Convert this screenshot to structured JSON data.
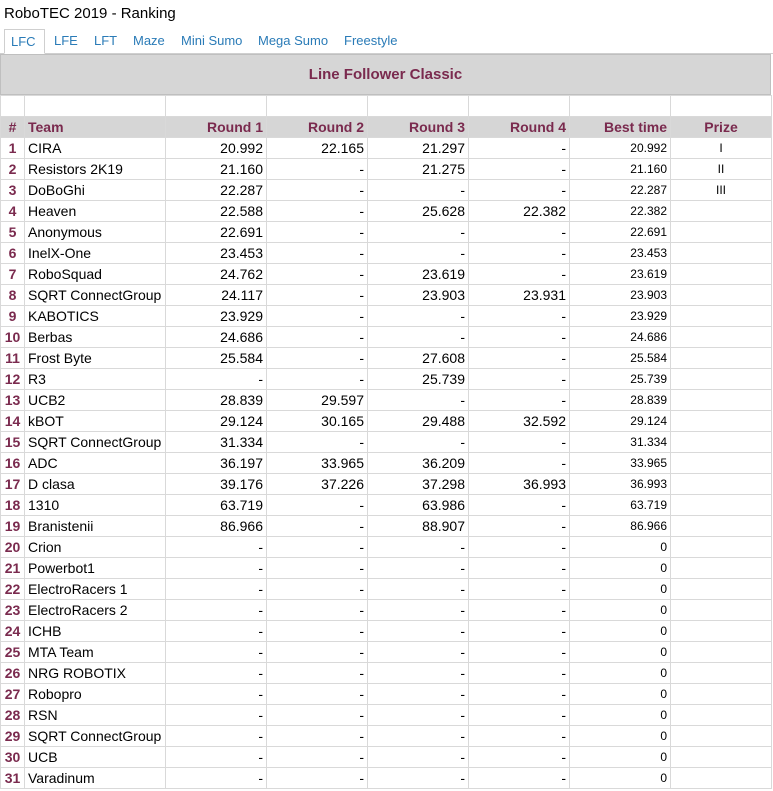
{
  "app": {
    "title": "RoboTEC 2019 - Ranking"
  },
  "tabs": [
    {
      "label": "LFC",
      "active": true
    },
    {
      "label": "LFE",
      "active": false
    },
    {
      "label": "LFT",
      "active": false
    },
    {
      "label": "Maze",
      "active": false
    },
    {
      "label": "Mini Sumo",
      "active": false
    },
    {
      "label": "Mega Sumo",
      "active": false
    },
    {
      "label": "Freestyle",
      "active": false
    }
  ],
  "section": {
    "title": "Line Follower Classic"
  },
  "table": {
    "columns": [
      "#",
      "Team",
      "Round 1",
      "Round 2",
      "Round 3",
      "Round 4",
      "Best time",
      "Prize"
    ],
    "rows": [
      [
        "1",
        "CIRA",
        "20.992",
        "22.165",
        "21.297",
        "-",
        "20.992",
        "I"
      ],
      [
        "2",
        "Resistors 2K19",
        "21.160",
        "-",
        "21.275",
        "-",
        "21.160",
        "II"
      ],
      [
        "3",
        "DoBoGhi",
        "22.287",
        "-",
        "-",
        "-",
        "22.287",
        "III"
      ],
      [
        "4",
        "Heaven",
        "22.588",
        "-",
        "25.628",
        "22.382",
        "22.382",
        ""
      ],
      [
        "5",
        "Anonymous",
        "22.691",
        "-",
        "-",
        "-",
        "22.691",
        ""
      ],
      [
        "6",
        "InelX-One",
        "23.453",
        "-",
        "-",
        "-",
        "23.453",
        ""
      ],
      [
        "7",
        "RoboSquad",
        "24.762",
        "-",
        "23.619",
        "-",
        "23.619",
        ""
      ],
      [
        "8",
        "SQRT ConnectGroup",
        "24.117",
        "-",
        "23.903",
        "23.931",
        "23.903",
        ""
      ],
      [
        "9",
        "KABOTICS",
        "23.929",
        "-",
        "-",
        "-",
        "23.929",
        ""
      ],
      [
        "10",
        "Berbas",
        "24.686",
        "-",
        "-",
        "-",
        "24.686",
        ""
      ],
      [
        "11",
        "Frost Byte",
        "25.584",
        "-",
        "27.608",
        "-",
        "25.584",
        ""
      ],
      [
        "12",
        "R3",
        "-",
        "-",
        "25.739",
        "-",
        "25.739",
        ""
      ],
      [
        "13",
        "UCB2",
        "28.839",
        "29.597",
        "-",
        "-",
        "28.839",
        ""
      ],
      [
        "14",
        "kBOT",
        "29.124",
        "30.165",
        "29.488",
        "32.592",
        "29.124",
        ""
      ],
      [
        "15",
        "SQRT ConnectGroup",
        "31.334",
        "-",
        "-",
        "-",
        "31.334",
        ""
      ],
      [
        "16",
        "ADC",
        "36.197",
        "33.965",
        "36.209",
        "-",
        "33.965",
        ""
      ],
      [
        "17",
        "D clasa",
        "39.176",
        "37.226",
        "37.298",
        "36.993",
        "36.993",
        ""
      ],
      [
        "18",
        "1310",
        "63.719",
        "-",
        "63.986",
        "-",
        "63.719",
        ""
      ],
      [
        "19",
        "Branistenii",
        "86.966",
        "-",
        "88.907",
        "-",
        "86.966",
        ""
      ],
      [
        "20",
        "Crion",
        "-",
        "-",
        "-",
        "-",
        "0",
        ""
      ],
      [
        "21",
        "Powerbot1",
        "-",
        "-",
        "-",
        "-",
        "0",
        ""
      ],
      [
        "22",
        "ElectroRacers 1",
        "-",
        "-",
        "-",
        "-",
        "0",
        ""
      ],
      [
        "23",
        "ElectroRacers 2",
        "-",
        "-",
        "-",
        "-",
        "0",
        ""
      ],
      [
        "24",
        "ICHB",
        "-",
        "-",
        "-",
        "-",
        "0",
        ""
      ],
      [
        "25",
        "MTA Team",
        "-",
        "-",
        "-",
        "-",
        "0",
        ""
      ],
      [
        "26",
        "NRG ROBOTIX",
        "-",
        "-",
        "-",
        "-",
        "0",
        ""
      ],
      [
        "27",
        "Robopro",
        "-",
        "-",
        "-",
        "-",
        "0",
        ""
      ],
      [
        "28",
        "RSN",
        "-",
        "-",
        "-",
        "-",
        "0",
        ""
      ],
      [
        "29",
        "SQRT ConnectGroup",
        "-",
        "-",
        "-",
        "-",
        "0",
        ""
      ],
      [
        "30",
        "UCB",
        "-",
        "-",
        "-",
        "-",
        "0",
        ""
      ],
      [
        "31",
        "Varadinum",
        "-",
        "-",
        "-",
        "-",
        "0",
        ""
      ]
    ]
  },
  "colors": {
    "accent": "#7a2a4e",
    "link": "#2a7bb7",
    "header_bg": "#d6d6d6"
  }
}
